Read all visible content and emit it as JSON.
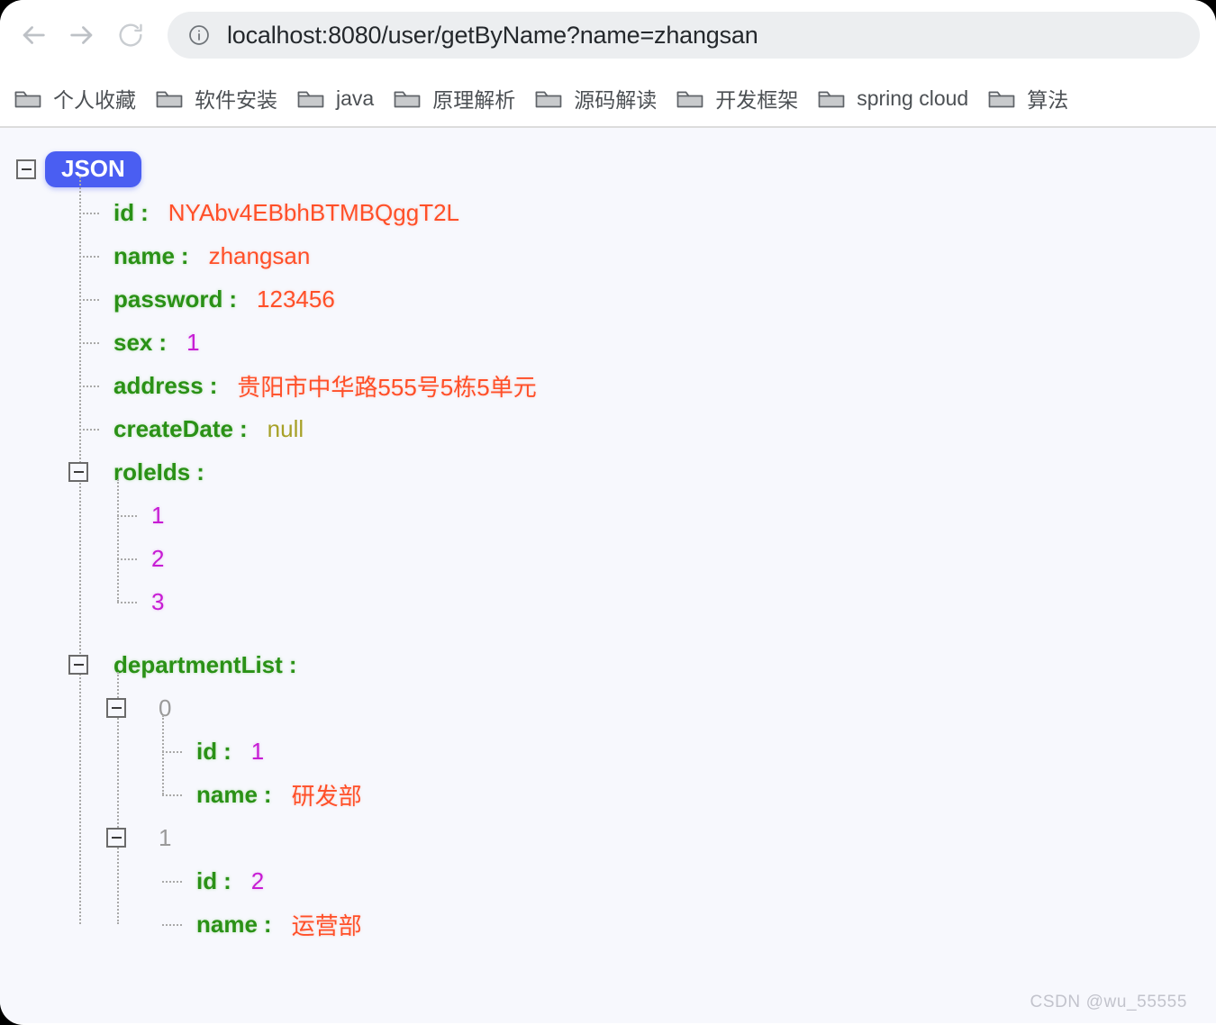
{
  "browser": {
    "nav": {
      "back_icon": "arrow-left-icon",
      "forward_icon": "arrow-right-icon",
      "reload_icon": "reload-icon"
    },
    "omnibox": {
      "info_icon": "info-circle-icon",
      "url": "localhost:8080/user/getByName?name=zhangsan"
    },
    "bookmarks": [
      {
        "label": "个人收藏"
      },
      {
        "label": "软件安装"
      },
      {
        "label": "java"
      },
      {
        "label": "原理解析"
      },
      {
        "label": "源码解读"
      },
      {
        "label": "开发框架"
      },
      {
        "label": "spring cloud"
      },
      {
        "label": "算法"
      }
    ]
  },
  "viewer": {
    "root_badge": "JSON",
    "rows": {
      "id": {
        "key": "id",
        "value": "NYAbv4EBbhBTMBQggT2L",
        "type": "string"
      },
      "name": {
        "key": "name",
        "value": "zhangsan",
        "type": "string"
      },
      "password": {
        "key": "password",
        "value": "123456",
        "type": "string"
      },
      "sex": {
        "key": "sex",
        "value": "1",
        "type": "number"
      },
      "address": {
        "key": "address",
        "value": "贵阳市中华路555号5栋5单元",
        "type": "string"
      },
      "createDate": {
        "key": "createDate",
        "value": "null",
        "type": "null"
      },
      "roleIds": {
        "key": "roleIds"
      },
      "departmentList": {
        "key": "departmentList"
      }
    },
    "roleIds_values": [
      {
        "value": "1",
        "type": "number"
      },
      {
        "value": "2",
        "type": "number"
      },
      {
        "value": "3",
        "type": "number"
      }
    ],
    "departments": [
      {
        "index": "0",
        "id_key": "id",
        "id_value": "1",
        "name_key": "name",
        "name_value": "研发部"
      },
      {
        "index": "1",
        "id_key": "id",
        "id_value": "2",
        "name_key": "name",
        "name_value": "运营部"
      }
    ]
  },
  "watermark": "CSDN @wu_55555",
  "colors": {
    "key": "#2a9116",
    "string": "#ff4f28",
    "number": "#c71cd4",
    "null": "#a7a128",
    "badge": "#4a5ef2",
    "canvas": "#f7f8fd"
  }
}
